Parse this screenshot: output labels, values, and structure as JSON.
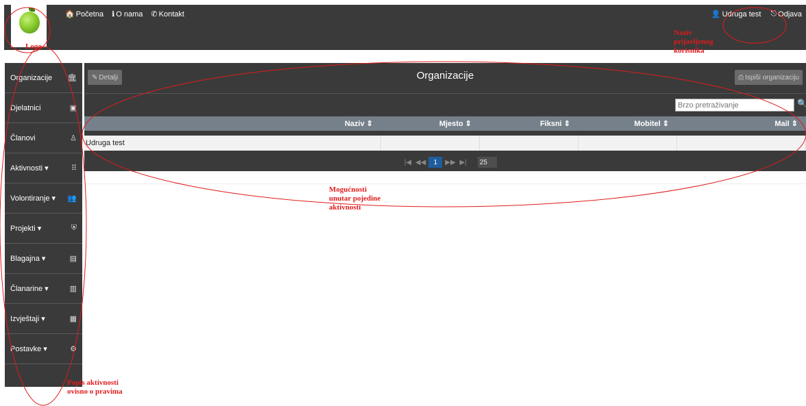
{
  "header": {
    "logo_label": "Logo",
    "nav": [
      {
        "icon": "home-icon",
        "glyph": "🏠",
        "label": "Početna"
      },
      {
        "icon": "info-icon",
        "glyph": "ℹ",
        "label": "O nama"
      },
      {
        "icon": "phone-icon",
        "glyph": "✆",
        "label": "Kontakt"
      }
    ],
    "user": {
      "icon": "user-icon",
      "glyph": "👤",
      "label": "Udruga test"
    },
    "logout": {
      "icon": "logout-icon",
      "glyph": "⎋",
      "label": "Odjava"
    }
  },
  "sidebar": {
    "items": [
      {
        "label": "Organizacije",
        "icon": "bank-icon",
        "glyph": "🏛"
      },
      {
        "label": "Djelatnici",
        "icon": "id-card-icon",
        "glyph": "▣"
      },
      {
        "label": "Članovi",
        "icon": "user-outline-icon",
        "glyph": "♙"
      },
      {
        "label": "Aktivnosti ▾",
        "icon": "grid-icon",
        "glyph": "⠿"
      },
      {
        "label": "Volontiranje ▾",
        "icon": "users-icon",
        "glyph": "👥"
      },
      {
        "label": "Projekti ▾",
        "icon": "shield-icon",
        "glyph": "⛨"
      },
      {
        "label": "Blagajna ▾",
        "icon": "cash-icon",
        "glyph": "▤"
      },
      {
        "label": "Članarine ▾",
        "icon": "barcode-icon",
        "glyph": "▥"
      },
      {
        "label": "Izvještaji ▾",
        "icon": "report-icon",
        "glyph": "▦"
      },
      {
        "label": "Postavke ▾",
        "icon": "gear-icon",
        "glyph": "⚙"
      }
    ]
  },
  "panel": {
    "title": "Organizacije",
    "details_button": "Detalji",
    "details_glyph": "✎",
    "print_button": "Ispiši organizaciju",
    "print_glyph": "⎙",
    "search_placeholder": "Brzo pretraživanje",
    "search_glyph": "🔍",
    "table": {
      "columns": [
        "Naziv ⇕",
        "Mjesto ⇕",
        "Fiksni ⇕",
        "Mobitel ⇕",
        "Mail ⇕"
      ],
      "rows": [
        [
          "Udruga test",
          "",
          "",
          "",
          ""
        ]
      ]
    },
    "pager": {
      "first": "|◀",
      "prev": "◀◀",
      "current": "1",
      "next": "▶▶",
      "last": "▶|",
      "page_size": "25"
    }
  },
  "annotations": {
    "logo": "Logo",
    "user": "Naziv prijavljenog korisnika",
    "options": "Mogućnosti unutar pojedine aktivnosti",
    "sidebar": "Popis aktivnosti ovisno o pravima"
  },
  "colors": {
    "bar_bg": "#3a3a3a",
    "table_header": "#76808a",
    "annotation": "#e01b1b",
    "pager_active": "#1f5d9e"
  }
}
